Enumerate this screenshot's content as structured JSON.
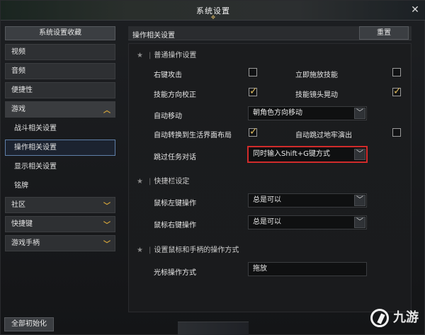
{
  "window": {
    "title": "系统设置",
    "close_icon": "close-icon"
  },
  "sidebar": {
    "header": "系统设置收藏",
    "items": [
      {
        "label": "视频"
      },
      {
        "label": "音频"
      },
      {
        "label": "便捷性"
      },
      {
        "label": "游戏"
      },
      {
        "label": "社区"
      },
      {
        "label": "快捷键"
      },
      {
        "label": "游戏手柄"
      }
    ],
    "game_subitems": [
      {
        "label": "战斗相关设置"
      },
      {
        "label": "操作相关设置"
      },
      {
        "label": "显示相关设置"
      },
      {
        "label": "铭牌"
      }
    ],
    "reset_all_label": "全部初始化"
  },
  "main": {
    "header_title": "操作相关设置",
    "reset_label": "重置",
    "sections": {
      "general_title": "普通操作设置",
      "hotbar_title": "快捷栏设定",
      "mouse_title": "设置鼠标和手柄的操作方式"
    },
    "rows": {
      "right_click_attack": "右键攻击",
      "instant_cast": "立即施放技能",
      "skill_direction": "技能方向校正",
      "skill_camera_shake": "技能镜头晃动",
      "auto_move": "自动移动",
      "auto_move_value": "朝角色方向移动",
      "auto_switch_layout": "自动转换到生活界面布局",
      "auto_skip_dungeon": "自动跳过地牢演出",
      "skip_quest_dialog": "跳过任务对话",
      "skip_quest_dialog_value": "同时输入Shift+G键方式",
      "left_click_action": "鼠标左键操作",
      "left_click_value": "总是可以",
      "right_click_action": "鼠标右键操作",
      "right_click_value": "总是可以",
      "cursor_mode": "光标操作方式",
      "cursor_mode_value": "拖放"
    },
    "checkboxes": {
      "right_click_attack": false,
      "instant_cast": false,
      "skill_direction": true,
      "skill_camera_shake": true,
      "auto_switch_layout": true,
      "auto_skip_dungeon": false
    }
  },
  "watermark": {
    "text": "九游"
  },
  "colors": {
    "accent_gold": "#d6a63a",
    "highlight_red": "#d12b2b",
    "active_blue": "#5f7fa8"
  }
}
